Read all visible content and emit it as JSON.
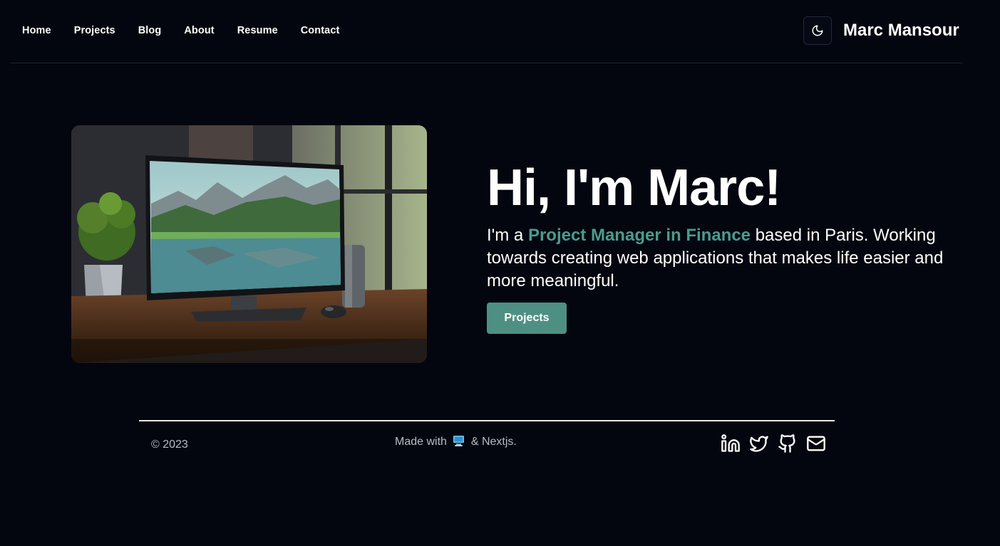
{
  "nav": {
    "items": [
      {
        "label": "Home"
      },
      {
        "label": "Projects"
      },
      {
        "label": "Blog"
      },
      {
        "label": "About"
      },
      {
        "label": "Resume"
      },
      {
        "label": "Contact"
      }
    ]
  },
  "header": {
    "theme_toggle_icon": "moon-icon",
    "brand": "Marc Mansour"
  },
  "hero": {
    "image_icon": "desk-computer-photo",
    "title": "Hi, I'm Marc!",
    "intro_prefix": "I'm a ",
    "role": "Project Manager in Finance",
    "intro_suffix": " based in Paris. Working towards creating web applications that makes life easier and more meaningful.",
    "button_label": "Projects"
  },
  "footer": {
    "copyright": "© 2023",
    "made_with_prefix": "Made with",
    "made_with_suffix": "& Nextjs.",
    "made_with_icon": "computer-icon",
    "socials": [
      {
        "icon": "linkedin-icon"
      },
      {
        "icon": "twitter-icon"
      },
      {
        "icon": "github-icon"
      },
      {
        "icon": "mail-icon"
      }
    ]
  },
  "colors": {
    "background": "#03060f",
    "accent": "#4b9b8e",
    "button": "#4e8f84"
  }
}
